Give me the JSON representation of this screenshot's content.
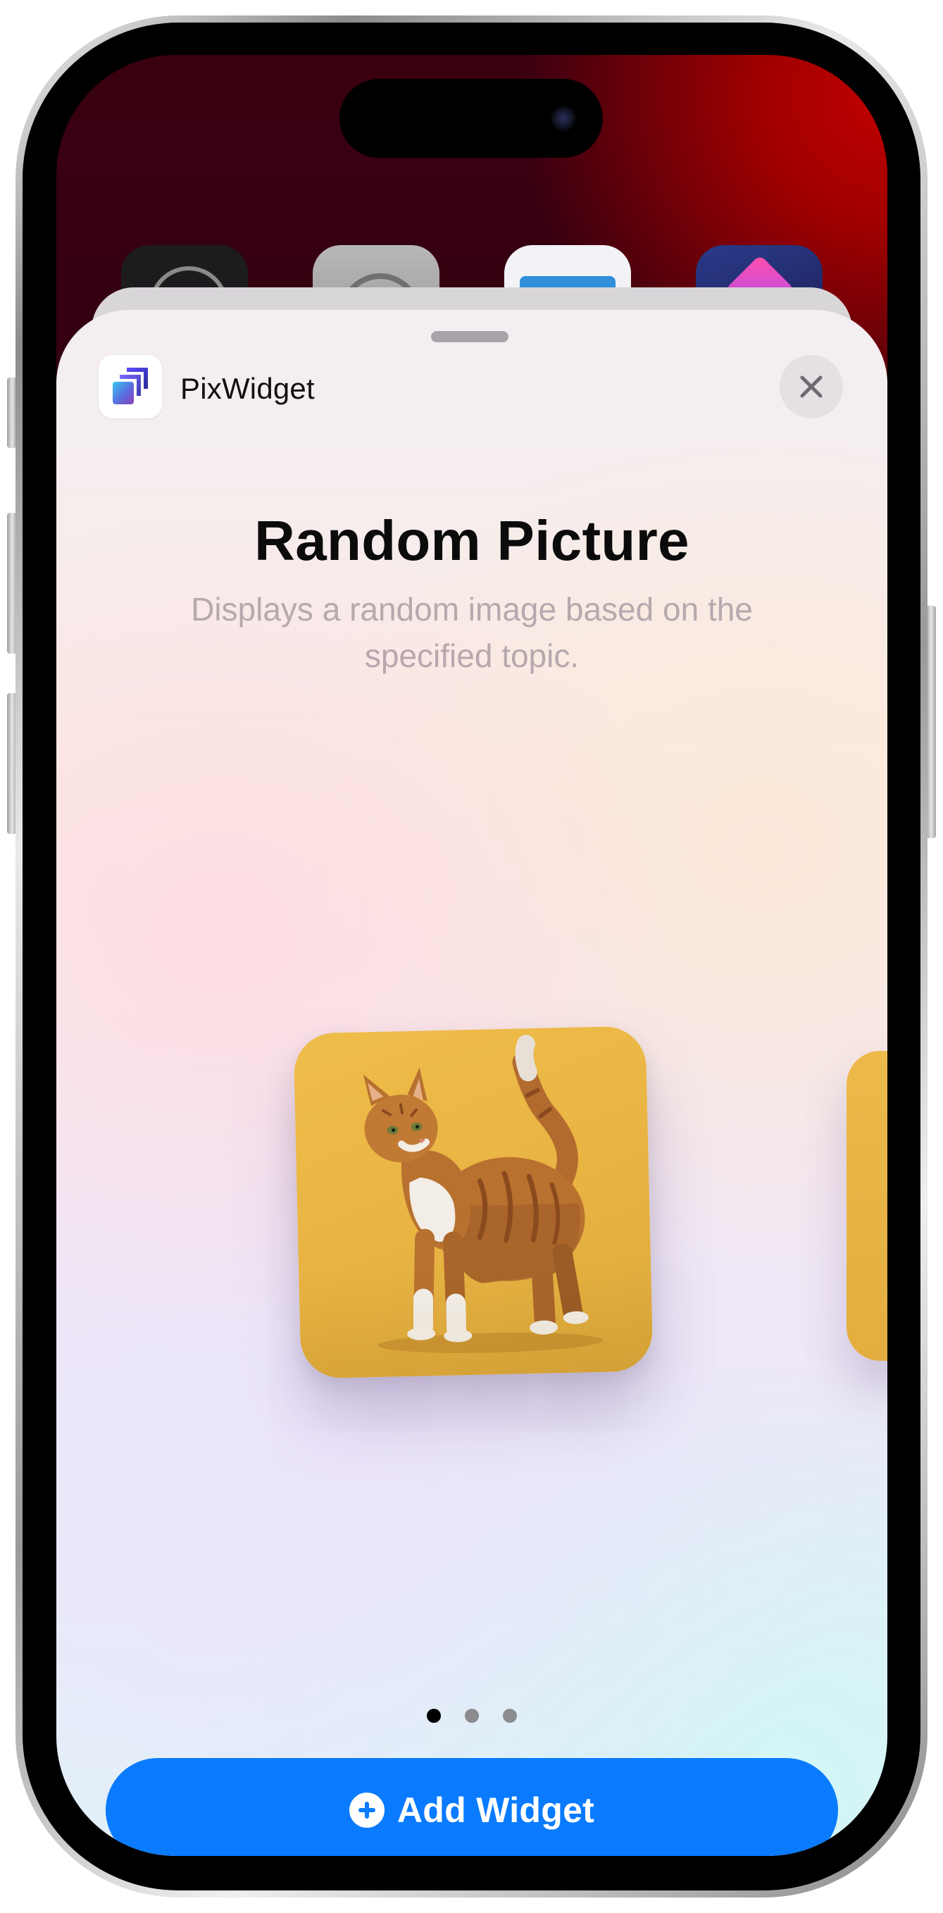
{
  "sheet": {
    "app_name": "PixWidget",
    "close_icon": "xmark-icon",
    "app_icon": "pixwidget-logo-icon"
  },
  "widget": {
    "title": "Random Picture",
    "description": "Displays a random image based on the specified topic.",
    "preview_subject": "orange tabby cat on yellow background",
    "page_count": 3,
    "current_page": 1
  },
  "actions": {
    "add_label": "Add Widget",
    "add_icon": "plus-circle-icon"
  },
  "colors": {
    "accent": "#0a7bff",
    "subtitle": "#b7a8ae",
    "widget_background": "#e8b342"
  }
}
